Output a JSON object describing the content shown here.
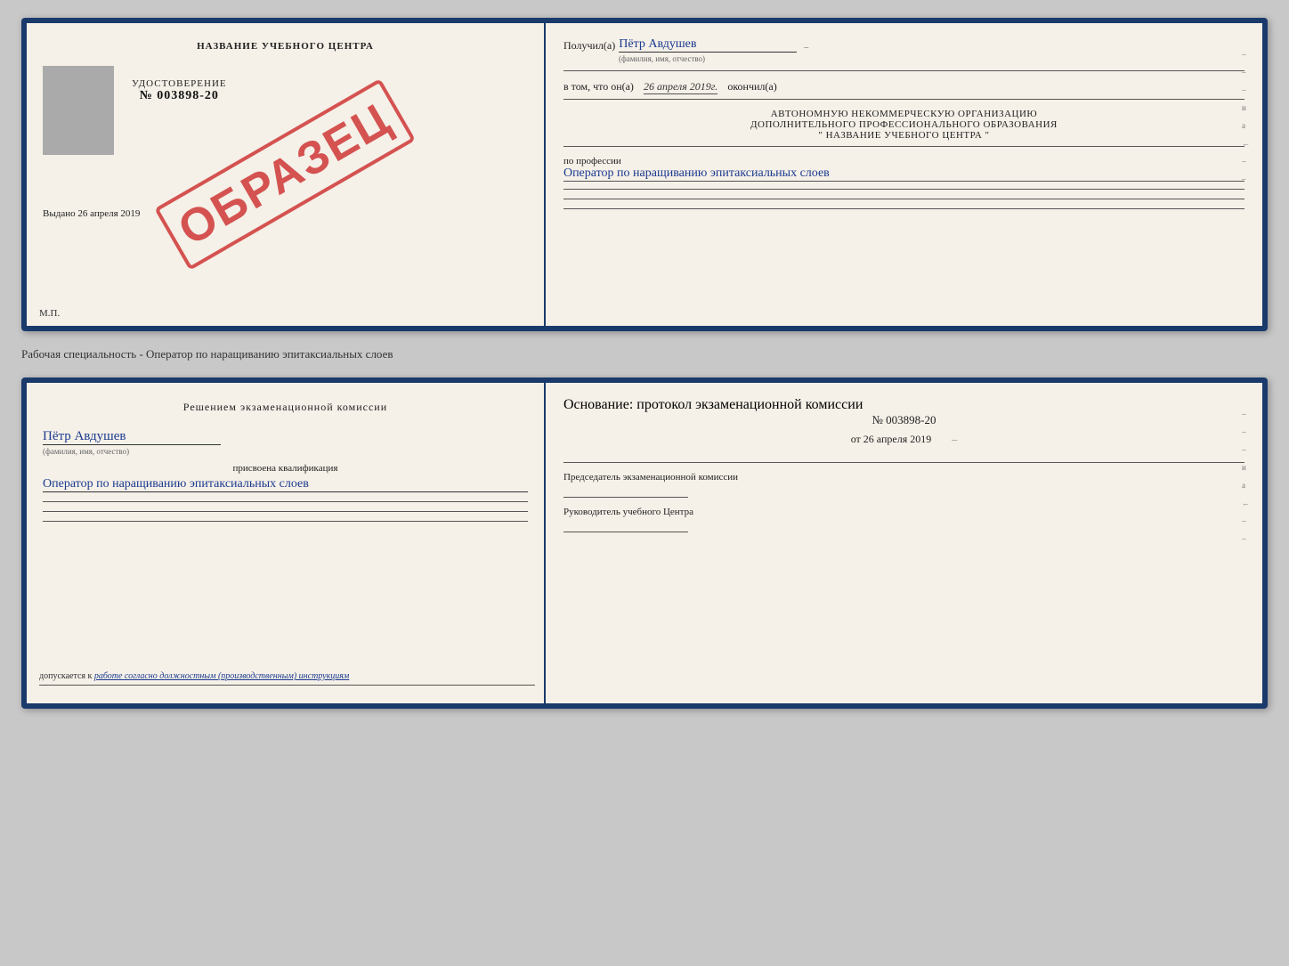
{
  "top_cert": {
    "left": {
      "school_name": "НАЗВАНИЕ УЧЕБНОГО ЦЕНТРА",
      "cert_label": "УДОСТОВЕРЕНИЕ",
      "cert_number": "№ 003898-20",
      "issued_label": "Выдано",
      "issued_date": "26 апреля 2019",
      "mp_label": "М.П.",
      "stamp_text": "ОБРАЗЕЦ"
    },
    "right": {
      "recipient_prefix": "Получил(а)",
      "recipient_name": "Пётр Авдушев",
      "fio_hint": "(фамилия, имя, отчество)",
      "date_prefix": "в том, что он(а)",
      "date_value": "26 апреля 2019г.",
      "date_suffix": "окончил(а)",
      "org_line1": "АВТОНОМНУЮ НЕКОММЕРЧЕСКУЮ ОРГАНИЗАЦИЮ",
      "org_line2": "ДОПОЛНИТЕЛЬНОГО ПРОФЕССИОНАЛЬНОГО ОБРАЗОВАНИЯ",
      "org_line3": "\" НАЗВАНИЕ УЧЕБНОГО ЦЕНТРА \"",
      "profession_prefix": "по профессии",
      "profession_value": "Оператор по наращиванию эпитаксиальных слоев"
    }
  },
  "between": {
    "text": "Рабочая специальность - Оператор по наращиванию эпитаксиальных слоев"
  },
  "bottom_cert": {
    "left": {
      "komissia_title": "Решением  экзаменационной  комиссии",
      "recipient_name": "Пётр Авдушев",
      "fio_hint": "(фамилия, имя, отчество)",
      "qualification_label": "присвоена квалификация",
      "qualification_value": "Оператор по наращиванию эпитаксиальных слоев",
      "допускается_prefix": "допускается к",
      "допускается_value": "работе согласно должностным (производственным) инструкциям"
    },
    "right": {
      "osnowanie_label": "Основание: протокол экзаменационной  комиссии",
      "protocol_number": "№ 003898-20",
      "protocol_date_prefix": "от",
      "protocol_date": "26 апреля 2019",
      "chairman_title": "Председатель экзаменационной комиссии",
      "director_title": "Руководитель учебного Центра"
    }
  },
  "corner_labels": {
    "и": "и",
    "а": "а",
    "left_arrow": "←",
    "dashes": [
      "–",
      "–",
      "–",
      "–",
      "–",
      "–"
    ]
  }
}
